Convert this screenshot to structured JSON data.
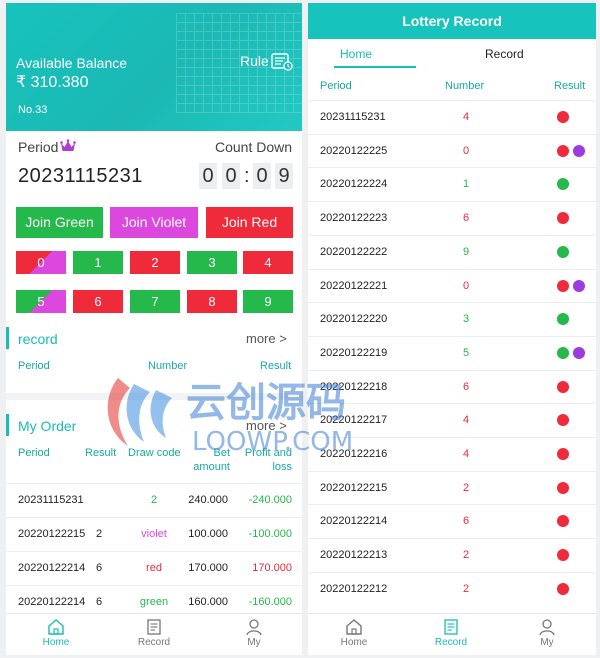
{
  "left": {
    "balance_label": "Available Balance",
    "balance_value": "₹ 310.380",
    "account_no": "No.33",
    "rule_label": "Rule",
    "period_label": "Period",
    "countdown_label": "Count Down",
    "period_value": "20231115231",
    "countdown_digits": [
      "0",
      "0",
      "0",
      "9"
    ],
    "countdown_sep": ":",
    "join_buttons": [
      "Join Green",
      "Join Violet",
      "Join Red"
    ],
    "numbers": [
      "0",
      "1",
      "2",
      "3",
      "4",
      "5",
      "6",
      "7",
      "8",
      "9"
    ],
    "record": {
      "title": "record",
      "more": "more >",
      "headers": [
        "Period",
        "Number",
        "Result"
      ]
    },
    "order": {
      "title": "My Order",
      "more": "more >",
      "headers": [
        "Period",
        "Result",
        "Draw code",
        "Bet amount",
        "Profit and loss"
      ],
      "rows": [
        {
          "period": "20231115231",
          "result": "",
          "draw": "2",
          "bet": "240.000",
          "pl": "-240.000"
        },
        {
          "period": "20220122215",
          "result": "2",
          "draw": "violet",
          "bet": "100.000",
          "pl": "-100.000"
        },
        {
          "period": "20220122214",
          "result": "6",
          "draw": "red",
          "bet": "170.000",
          "pl": "170.000"
        },
        {
          "period": "20220122214",
          "result": "6",
          "draw": "green",
          "bet": "160.000",
          "pl": "-160.000"
        }
      ]
    },
    "tabs": [
      "Home",
      "Record",
      "My"
    ]
  },
  "right": {
    "title": "Lottery Record",
    "tabs": [
      "Home",
      "Record",
      "My"
    ],
    "headers": [
      "Period",
      "Number",
      "Result"
    ],
    "rows": [
      {
        "period": "20231115231",
        "number": "4",
        "dots": [
          "red"
        ]
      },
      {
        "period": "20220122225",
        "number": "0",
        "dots": [
          "red",
          "violet"
        ]
      },
      {
        "period": "20220122224",
        "number": "1",
        "dots": [
          "green"
        ]
      },
      {
        "period": "20220122223",
        "number": "6",
        "dots": [
          "red"
        ]
      },
      {
        "period": "20220122222",
        "number": "9",
        "dots": [
          "green"
        ]
      },
      {
        "period": "20220122221",
        "number": "0",
        "dots": [
          "red",
          "violet"
        ]
      },
      {
        "period": "20220122220",
        "number": "3",
        "dots": [
          "green"
        ]
      },
      {
        "period": "20220122219",
        "number": "5",
        "dots": [
          "green",
          "violet"
        ]
      },
      {
        "period": "20220122218",
        "number": "6",
        "dots": [
          "red"
        ]
      },
      {
        "period": "20220122217",
        "number": "4",
        "dots": [
          "red"
        ]
      },
      {
        "period": "20220122216",
        "number": "4",
        "dots": [
          "red"
        ]
      },
      {
        "period": "20220122215",
        "number": "2",
        "dots": [
          "red"
        ]
      },
      {
        "period": "20220122214",
        "number": "6",
        "dots": [
          "red"
        ]
      },
      {
        "period": "20220122213",
        "number": "2",
        "dots": [
          "red"
        ]
      },
      {
        "period": "20220122212",
        "number": "2",
        "dots": [
          "red"
        ]
      }
    ]
  },
  "watermark": {
    "cn": "云创源码",
    "en": "LOOWP.COM"
  },
  "colors": {
    "teal": "#19bdb7",
    "green": "#25b84a",
    "red": "#ee2a3b",
    "violet": "#dc48dd"
  }
}
